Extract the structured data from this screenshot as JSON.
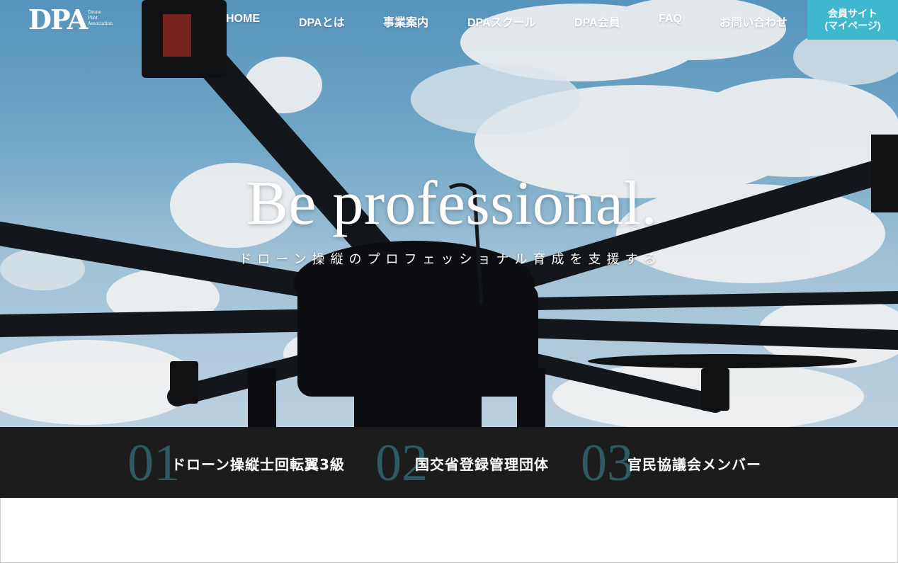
{
  "brand": {
    "logo_text": "DPA",
    "logo_sub": [
      "Drone",
      "Pilot",
      "Association"
    ]
  },
  "nav": {
    "items": [
      "HOME",
      "DPAとは",
      "事業案内",
      "DPAスクール",
      "DPA会員",
      "FAQ",
      "お問い合わせ"
    ],
    "member_site_line1": "会員サイト",
    "member_site_line2": "(マイページ)"
  },
  "hero": {
    "headline": "Be professional.",
    "subline": "ドローン操縦のプロフェッショナル育成を支援する"
  },
  "features": [
    {
      "number": "01",
      "label": "ドローン操縦士回転翼3級"
    },
    {
      "number": "02",
      "label": "国交省登録管理団体"
    },
    {
      "number": "03",
      "label": "官民協議会メンバー"
    }
  ],
  "colors": {
    "accent": "#3fb8cf",
    "feature_bg": "#1c1c1c",
    "feature_number": "#2e5a63"
  }
}
